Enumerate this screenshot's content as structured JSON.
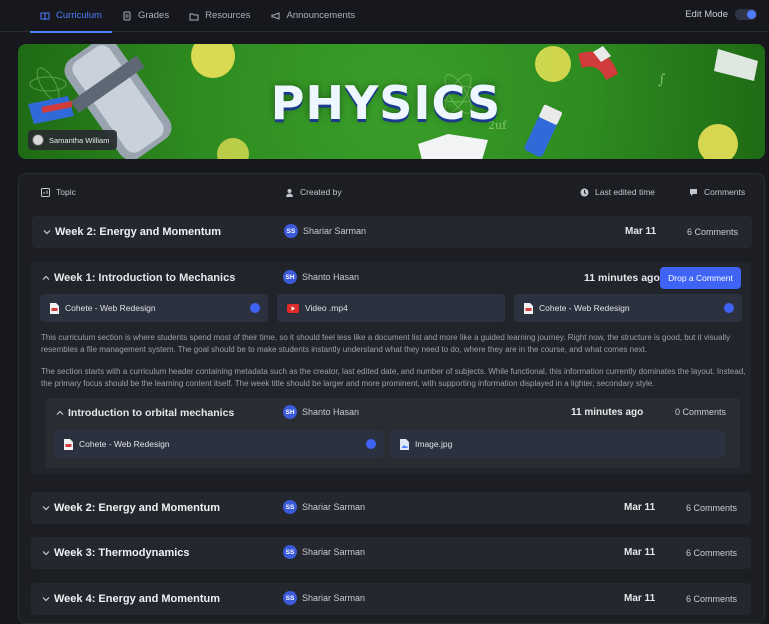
{
  "nav": {
    "tabs": [
      {
        "label": "Curriculum",
        "icon": "book-icon",
        "active": true
      },
      {
        "label": "Grades",
        "icon": "document-icon"
      },
      {
        "label": "Resources",
        "icon": "folder-icon"
      },
      {
        "label": "Announcements",
        "icon": "megaphone-icon"
      }
    ],
    "edit_mode_label": "Edit Mode"
  },
  "banner": {
    "title": "PHYSICS",
    "author": "Samantha William"
  },
  "table": {
    "headers": {
      "topic": "Topic",
      "created_by": "Created by",
      "last_edited": "Last edited time",
      "comments": "Comments"
    },
    "rows_top": [
      {
        "title": "Week 2: Energy and Momentum",
        "initials": "SS",
        "creator": "Shariar Sarman",
        "date": "Mar 11",
        "comments": "6 Comments"
      }
    ],
    "expanded": {
      "title": "Week 1: Introduction to Mechanics",
      "initials": "SH",
      "creator": "Shanto Hasan",
      "date": "11 minutes ago",
      "button": "Drop a Comment",
      "attachments": [
        {
          "name": "Cohete - Web Redesign",
          "type": "pdf"
        },
        {
          "name": "Video .mp4",
          "type": "video"
        },
        {
          "name": "Cohete - Web Redesign",
          "type": "pdf"
        }
      ],
      "description_1": "This curriculum section is where students spend most of their time, so it should feel less like a document list and more like a guided learning journey. Right now, the structure is good, but it visually resembles a file management system. The goal should be to make students instantly understand what they need to do, where they are in the course, and what comes next.",
      "description_2": "The section starts with a curriculum header containing metadata such as the creator, last edited date, and number of subjects. While functional, this information currently dominates the layout. Instead, the primary focus should be the learning content itself. The week title should be larger and more prominent, with supporting information displayed in a lighter, secondary style.",
      "sub": {
        "title": "Introduction to orbital mechanics",
        "initials": "SH",
        "creator": "Shanto Hasan",
        "date": "11 minutes ago",
        "comments": "0 Comments",
        "attachments": [
          {
            "name": "Cohete - Web Redesign",
            "type": "pdf"
          },
          {
            "name": "Image.jpg",
            "type": "image"
          }
        ]
      }
    },
    "rows_bottom": [
      {
        "title": "Week 2: Energy and Momentum",
        "initials": "SS",
        "creator": "Shariar Sarman",
        "date": "Mar 11",
        "comments": "6 Comments"
      },
      {
        "title": "Week 3: Thermodynamics",
        "initials": "SS",
        "creator": "Shariar Sarman",
        "date": "Mar 11",
        "comments": "6 Comments"
      },
      {
        "title": "Week 4: Energy and Momentum",
        "initials": "SS",
        "creator": "Shariar Sarman",
        "date": "Mar 11",
        "comments": "6 Comments"
      }
    ]
  },
  "colors": {
    "accent": "#3f63f5",
    "background": "#17181d",
    "banner_green": "#3aa02a"
  }
}
